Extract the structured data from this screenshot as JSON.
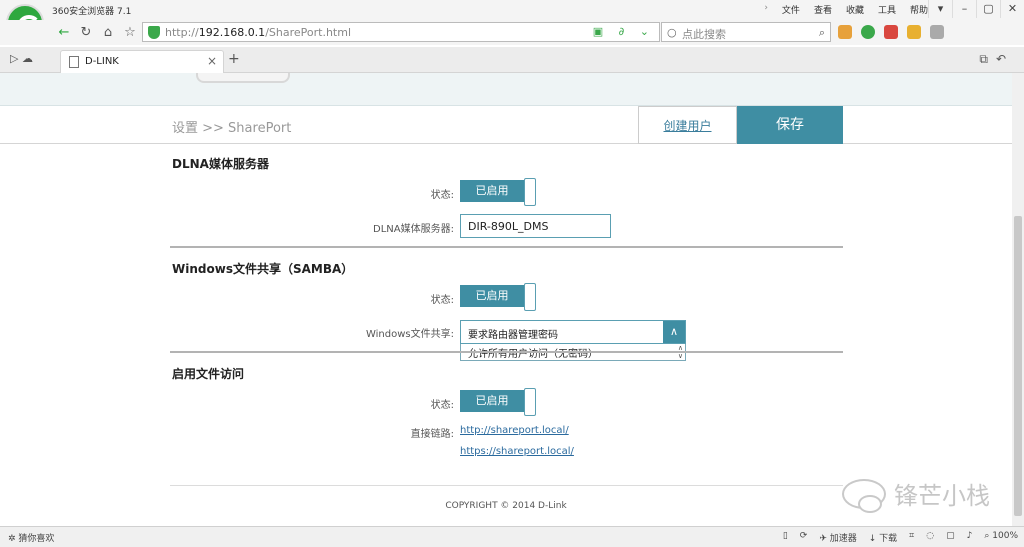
{
  "browser": {
    "title": "360安全浏览器 7.1",
    "menus": [
      "文件",
      "查看",
      "收藏",
      "工具",
      "帮助"
    ],
    "url_prefix": "http://",
    "url_host": "192.168.0.1",
    "url_path": "/SharePort.html",
    "search_placeholder": "点此搜索",
    "tab_title": "D-LINK"
  },
  "header": {
    "breadcrumb": "设置 >> SharePort",
    "create_user": "创建用户",
    "save": "保存"
  },
  "dlna": {
    "title": "DLNA媒体服务器",
    "status_label": "状态:",
    "status_value": "已启用",
    "server_label": "DLNA媒体服务器:",
    "server_value": "DIR-890L_DMS"
  },
  "samba": {
    "title": "Windows文件共享（SAMBA）",
    "status_label": "状态:",
    "status_value": "已启用",
    "share_label": "Windows文件共享:",
    "share_selected": "要求路由器管理密码",
    "share_option_2": "允许所有用户访问（无密码）"
  },
  "file_access": {
    "title": "启用文件访问",
    "status_label": "状态:",
    "status_value": "已启用",
    "link_label": "直接链路:",
    "link_http": "http://shareport.local/",
    "link_https": "https://shareport.local/"
  },
  "footer": {
    "copyright": "COPYRIGHT © 2014 D-Link",
    "watermark": "锋芒小栈"
  },
  "statusbar": {
    "left": "猜你喜欢",
    "accelerator": "加速器",
    "download": "下载",
    "zoom": "100%"
  },
  "colors": {
    "accent": "#3f8ea3",
    "link": "#2a6a9e"
  }
}
